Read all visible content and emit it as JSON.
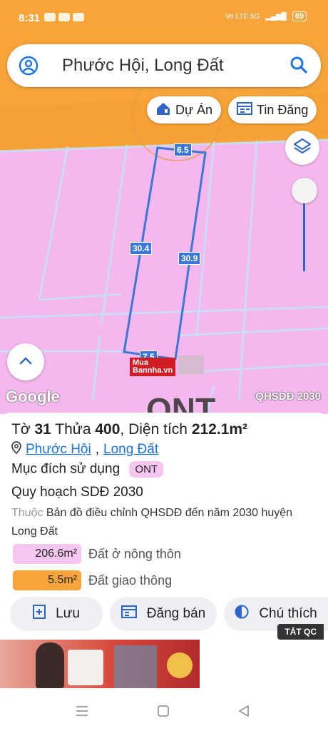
{
  "status_bar": {
    "time": "8:31",
    "network": "Vo LTE 5G",
    "battery": "89"
  },
  "search": {
    "query": "Phước Hội, Long Đất"
  },
  "map_buttons": {
    "du_an": "Dự Án",
    "tin_dang": "Tin Đăng"
  },
  "dimensions": {
    "top": "6.5",
    "left": "30.4",
    "right": "30.9",
    "bottom": "7.5"
  },
  "map_footer": {
    "provider": "Google",
    "plan_label": "QHSDĐ 2030"
  },
  "watermark": {
    "line1": "Mua",
    "line2": "Bannha.vn"
  },
  "parcel": {
    "to_label": "Tờ",
    "to_value": "31",
    "thua_label": "Thửa",
    "thua_value": "400",
    "area_label": "Diện tích",
    "area_value": "212.1m²",
    "ward": "Phước Hội",
    "district": "Long Đất",
    "purpose_label": "Mục đích sử dụng",
    "purpose_code": "ONT",
    "plan_title": "Quy hoạch SDĐ 2030",
    "belongs_label": "Thuộc",
    "belongs_text": "Bản đồ điều chỉnh QHSDĐ đến năm 2030 huyện Long Đất"
  },
  "land_uses": [
    {
      "area": "206.6m²",
      "label": "Đất ở nông thôn",
      "color": "#f6c6f0"
    },
    {
      "area": "5.5m²",
      "label": "Đất giao thông",
      "color": "#f7a53b"
    }
  ],
  "actions": {
    "save": "Lưu",
    "post": "Đăng bán",
    "legend": "Chú thích"
  },
  "ad_close": "TẮT QC",
  "colors": {
    "land_pink": "#f4b8ee",
    "road_orange": "#f7a53b",
    "dim_blue": "#3a78d8",
    "link": "#1a73e8"
  }
}
